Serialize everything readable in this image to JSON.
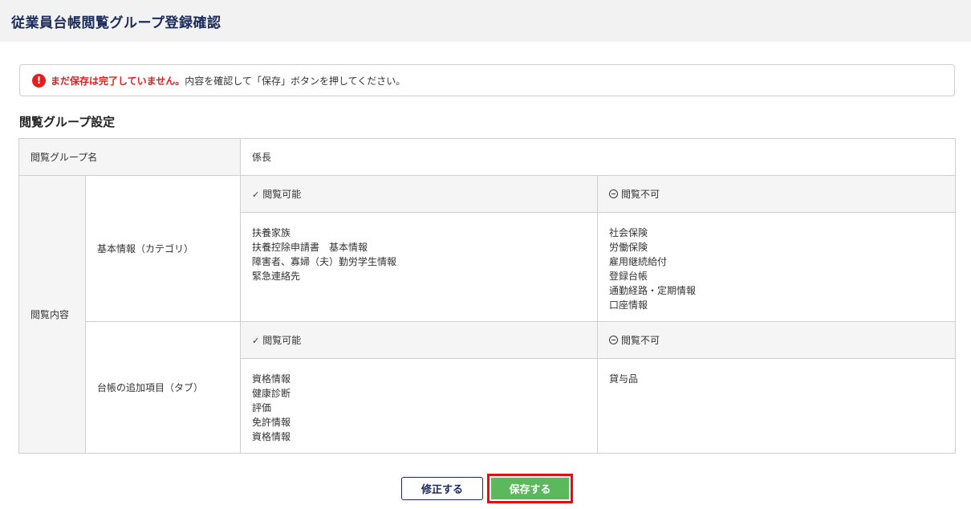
{
  "page_title": "従業員台帳閲覧グループ登録確認",
  "alert": {
    "icon": "exclamation-icon",
    "strong": "まだ保存は完了していません。",
    "text": "内容を確認して「保存」ボタンを押してください。"
  },
  "section_title": "閲覧グループ設定",
  "group_name_label": "閲覧グループ名",
  "group_name_value": "係長",
  "content_label": "閲覧内容",
  "allowed_label": "閲覧可能",
  "denied_label": "閲覧不可",
  "categories": [
    {
      "label": "基本情報（カテゴリ）",
      "allowed": [
        "扶養家族",
        "扶養控除申請書　基本情報",
        "障害者、寡婦（夫）勤労学生情報",
        "緊急連絡先"
      ],
      "denied": [
        "社会保険",
        "労働保険",
        "雇用継続給付",
        "登録台帳",
        "通勤経路・定期情報",
        "口座情報"
      ]
    },
    {
      "label": "台帳の追加項目（タブ）",
      "allowed": [
        "資格情報",
        "健康診断",
        "評価",
        "免許情報",
        "資格情報"
      ],
      "denied": [
        "貸与品"
      ]
    }
  ],
  "buttons": {
    "edit": "修正する",
    "save": "保存する"
  },
  "colors": {
    "accent": "#1a2a5a",
    "alert": "#e02020",
    "save": "#5cb85c",
    "highlight": "#e01010"
  }
}
